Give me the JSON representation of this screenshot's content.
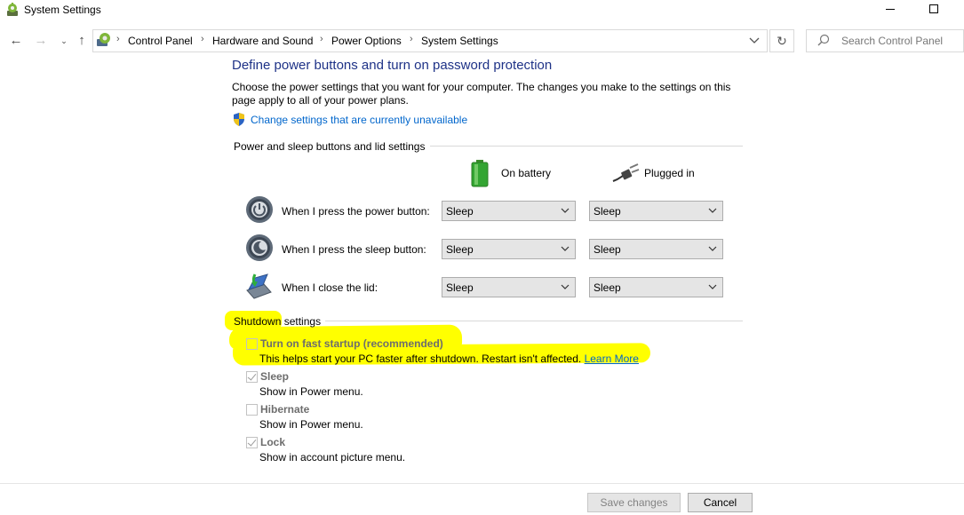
{
  "window": {
    "title": "System Settings",
    "icon": "system-settings-icon"
  },
  "navigation": {
    "breadcrumbs": [
      "Control Panel",
      "Hardware and Sound",
      "Power Options",
      "System Settings"
    ],
    "search_placeholder": "Search Control Panel"
  },
  "page": {
    "heading": "Define power buttons and turn on password protection",
    "description": "Choose the power settings that you want for your computer. The changes you make to the settings on this page apply to all of your power plans.",
    "change_link": "Change settings that are currently unavailable"
  },
  "power_group": {
    "title": "Power and sleep buttons and lid settings",
    "columns": {
      "battery": "On battery",
      "plugged": "Plugged in"
    },
    "rows": [
      {
        "label": "When I press the power button:",
        "icon": "power-button-icon",
        "battery": "Sleep",
        "plugged": "Sleep"
      },
      {
        "label": "When I press the sleep button:",
        "icon": "sleep-button-icon",
        "battery": "Sleep",
        "plugged": "Sleep"
      },
      {
        "label": "When I close the lid:",
        "icon": "laptop-lid-icon",
        "battery": "Sleep",
        "plugged": "Sleep"
      }
    ]
  },
  "shutdown_group": {
    "title": "Shutdown settings",
    "options": [
      {
        "label": "Turn on fast startup (recommended)",
        "description": "This helps start your PC faster after shutdown. Restart isn't affected.",
        "link": "Learn More",
        "checked": false
      },
      {
        "label": "Sleep",
        "description": "Show in Power menu.",
        "checked": true
      },
      {
        "label": "Hibernate",
        "description": "Show in Power menu.",
        "checked": false
      },
      {
        "label": "Lock",
        "description": "Show in account picture menu.",
        "checked": true
      }
    ]
  },
  "footer": {
    "save": "Save changes",
    "cancel": "Cancel"
  },
  "colors": {
    "heading": "#1e3287",
    "link": "#0066cc",
    "highlight": "#ffff00"
  }
}
